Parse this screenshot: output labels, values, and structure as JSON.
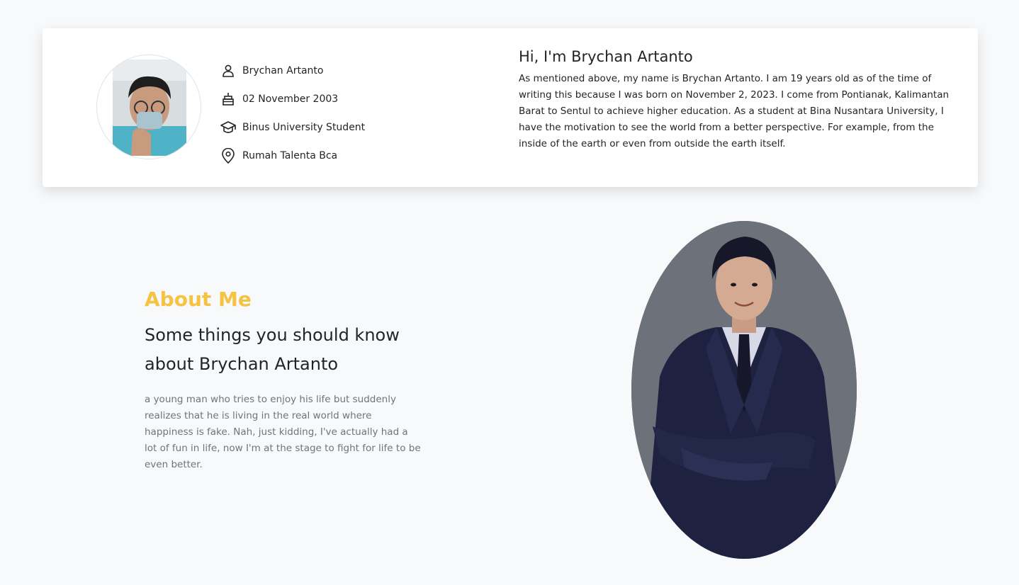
{
  "profile": {
    "avatar_alt": "profile photo",
    "details": [
      {
        "icon": "person-icon",
        "text": "Brychan Artanto"
      },
      {
        "icon": "cake-icon",
        "text": "02 November 2003"
      },
      {
        "icon": "graduation-cap-icon",
        "text": "Binus University Student"
      },
      {
        "icon": "location-pin-icon",
        "text": "Rumah Talenta Bca"
      }
    ],
    "intro_title": "Hi, I'm Brychan Artanto",
    "intro_text": "As mentioned above, my name is Brychan Artanto. I am 19 years old as of the time of writing this because I was born on November 2, 2023. I come from Pontianak, Kalimantan Barat to Sentul to achieve higher education. As a student at Bina Nusantara University, I have the motivation to see the world from a better perspective. For example, from the inside of the earth or even from outside the earth itself."
  },
  "about": {
    "label": "About Me",
    "heading": "Some things you should know about Brychan Artanto",
    "text": "a young man who tries to enjoy his life but suddenly realizes that he is living in the real world where happiness is fake. Nah, just kidding, I've actually had a lot of fun in life, now I'm at the stage to fight for life to be even better."
  },
  "colors": {
    "accent": "#f5c242",
    "muted_text": "#6c757d",
    "portrait_bg": "#6c717a"
  }
}
